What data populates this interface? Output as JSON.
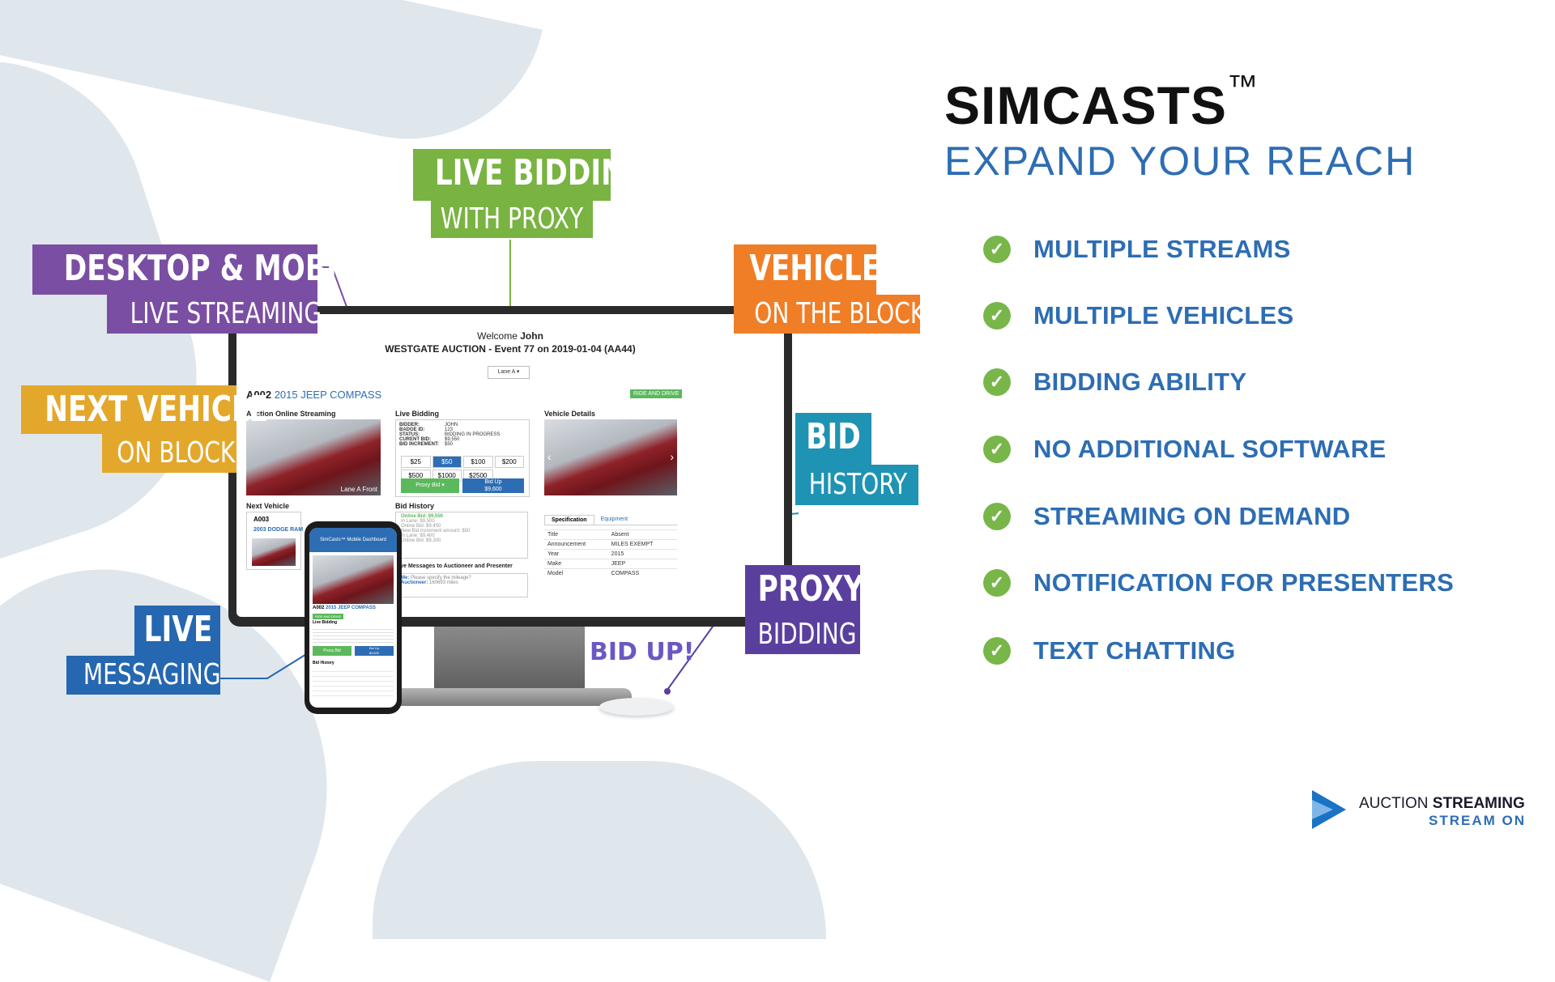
{
  "header": {
    "title": "SIMCASTS",
    "trademark": "™",
    "subtitle": "EXPAND YOUR REACH"
  },
  "features": [
    "MULTIPLE STREAMS",
    "MULTIPLE VEHICLES",
    "BIDDING ABILITY",
    "NO ADDITIONAL SOFTWARE",
    "STREAMING ON DEMAND",
    "NOTIFICATION FOR PRESENTERS",
    "TEXT CHATTING"
  ],
  "callouts": {
    "live_bidding": {
      "top": "LIVE BIDDING",
      "bottom": "WITH PROXY",
      "color_top": "#79b342",
      "color_bottom": "#79b342"
    },
    "desktop_mobile": {
      "top": "DESKTOP & MOBILE",
      "bottom": "LIVE STREAMING",
      "color_top": "#7a4ea3",
      "color_bottom": "#7a4ea3"
    },
    "vehicle_block": {
      "top": "VEHICLE",
      "bottom": "ON THE BLOCK",
      "color_top": "#f07e26",
      "color_bottom": "#f07e26"
    },
    "next_vehicle": {
      "top": "NEXT VEHICLE",
      "bottom": "ON BLOCK",
      "color_top": "#e3a82b",
      "color_bottom": "#e3a82b"
    },
    "bid_history": {
      "top": "BID",
      "bottom": "HISTORY",
      "color_top": "#1f93b3",
      "color_bottom": "#1f93b3"
    },
    "live_messaging": {
      "top": "LIVE",
      "bottom": "MESSAGING",
      "color_top": "#2567b0",
      "color_bottom": "#2567b0"
    },
    "proxy_bidding": {
      "top": "PROXY",
      "bottom": "BIDDING",
      "color_top": "#5b3f9e",
      "color_bottom": "#5b3f9e"
    }
  },
  "screen": {
    "welcome": "Welcome",
    "user": "John",
    "event": "WESTGATE AUCTION - Event 77 on 2019-01-04 (AA44)",
    "lane_select": "Lane A",
    "lot": "A002",
    "vehicle": "2015 JEEP COMPASS",
    "badge": "RIDE AND DRIVE",
    "stream_heading": "Auction Online Streaming",
    "stream_caption": "Lane A Front",
    "live_bidding_heading": "Live Bidding",
    "bid_info": [
      {
        "k": "BIDDER:",
        "v": "JOHN"
      },
      {
        "k": "BADGE ID:",
        "v": "123"
      },
      {
        "k": "STATUS:",
        "v": "BIDDING IN PROGRESS"
      },
      {
        "k": "CURENT BID:",
        "v": "$9,550"
      },
      {
        "k": "BID INCREMENT:",
        "v": "$50"
      }
    ],
    "increments": [
      "$25",
      "$50",
      "$100",
      "$200",
      "$500",
      "$1000",
      "$2500"
    ],
    "proxy_bid": "Proxy Bid",
    "bid_up": "Bid Up",
    "bid_up_amount": "$9,600",
    "vehicle_details_heading": "Vehicle Details",
    "next_vehicle_heading": "Next Vehicle",
    "next_lot": "A003",
    "next_vehicle": "2003 DODGE RAM",
    "bid_history_heading": "Bid History",
    "bid_history": [
      "Online Bid: $9,550",
      "In Lane: $9,500",
      "Online Bid: $9,450",
      "New Bid increment amount: $50",
      "In Lane: $9,400",
      "Online Bid: $9,300"
    ],
    "messages_heading": "Live Messages to Auctioneer and Presenter",
    "message_me_label": "Me:",
    "message_me": "Please specify the mileage?",
    "message_auct_label": "Auctioneer:",
    "message_auct": "160693 miles",
    "tabs": [
      "Specification",
      "Equipment"
    ],
    "spec": [
      {
        "k": "Title",
        "v": "Absent"
      },
      {
        "k": "Announcement",
        "v": "MILES EXEMPT"
      },
      {
        "k": "Year",
        "v": "2015"
      },
      {
        "k": "Make",
        "v": "JEEP"
      },
      {
        "k": "Model",
        "v": "COMPASS"
      }
    ]
  },
  "phone": {
    "app_title": "SimCasts™ Mobile Dashboard",
    "lot": "A002",
    "vehicle": "2015 JEEP COMPASS",
    "badge": "RIDE AND DRIVE",
    "live_bidding": "Live Bidding",
    "proxy_bid": "Proxy Bid",
    "bid_up": "Bid Up",
    "bid_up_amount": "$9,600",
    "bid_history": "Bid History"
  },
  "bid_up_text": "BID UP!",
  "logo": {
    "line1_a": "AUCTION",
    "line1_b": "STREAMING",
    "line2": "STREAM ON"
  },
  "colors": {
    "accent_blue": "#2d6db3",
    "check_green": "#78b64a",
    "background_shape": "#dfe6ec"
  }
}
